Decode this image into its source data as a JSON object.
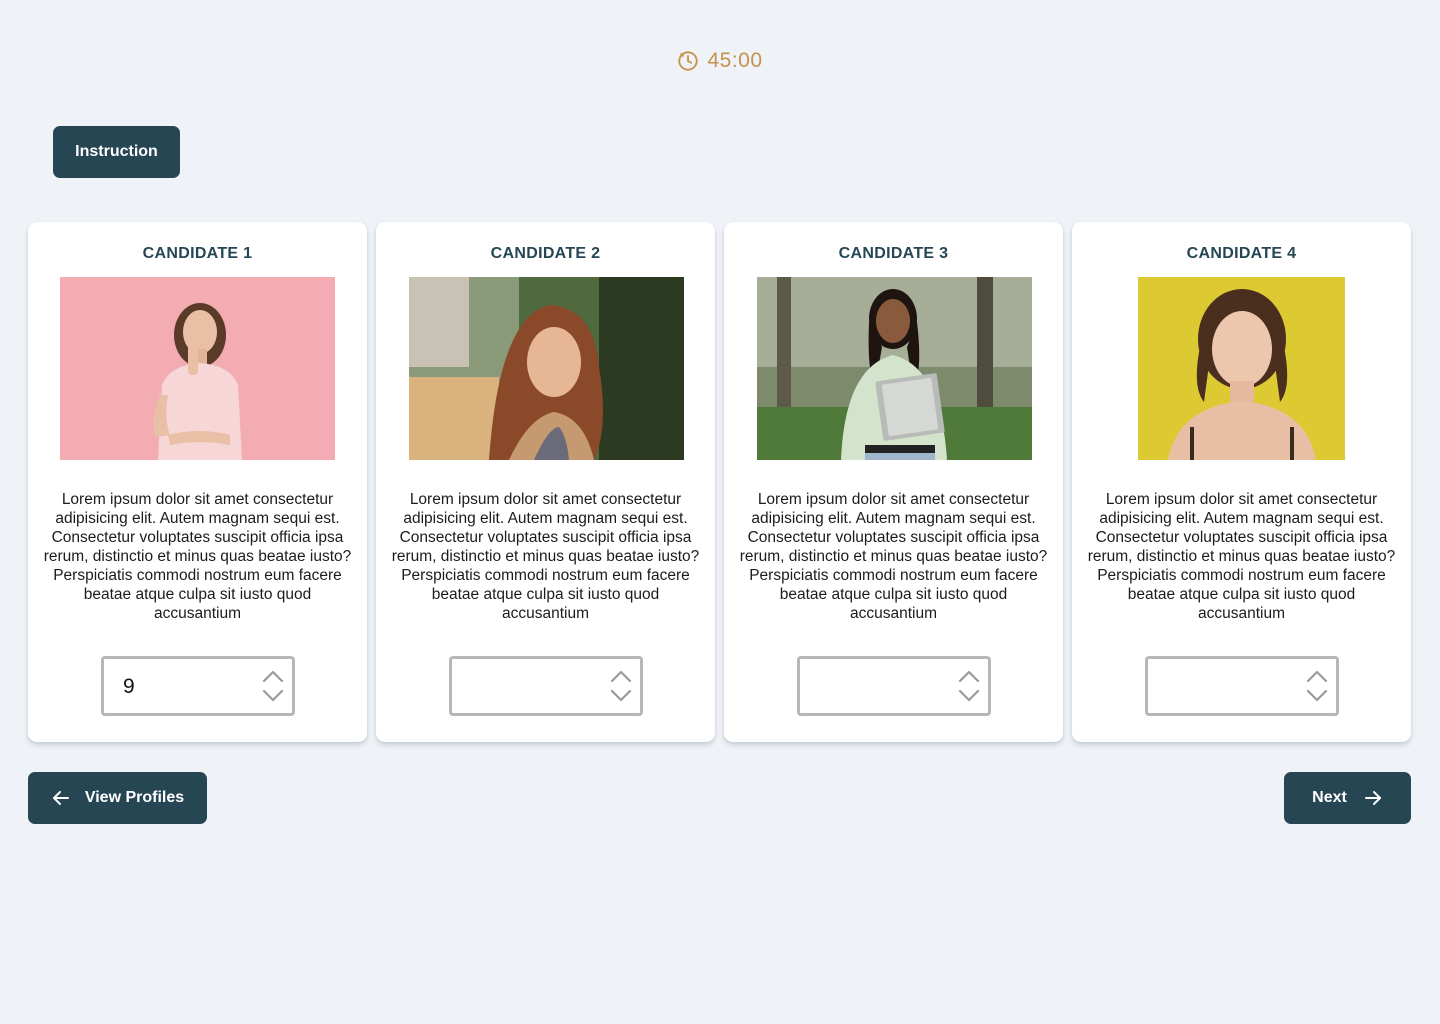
{
  "timer": {
    "icon": "clock-icon",
    "value": "45:00",
    "color": "#c5924b"
  },
  "instruction_button": {
    "label": "Instruction"
  },
  "candidates": [
    {
      "title": "CANDIDATE 1",
      "description": "Lorem ipsum dolor sit amet consectetur adipisicing elit. Autem magnam sequi est. Consectetur voluptates suscipit officia ipsa rerum, distinctio et minus quas beatae iusto? Perspiciatis commodi nostrum eum facere beatae atque culpa sit iusto quod accusantium",
      "rank_value": "9"
    },
    {
      "title": "CANDIDATE 2",
      "description": "Lorem ipsum dolor sit amet consectetur adipisicing elit. Autem magnam sequi est. Consectetur voluptates suscipit officia ipsa rerum, distinctio et minus quas beatae iusto? Perspiciatis commodi nostrum eum facere beatae atque culpa sit iusto quod accusantium",
      "rank_value": ""
    },
    {
      "title": "CANDIDATE 3",
      "description": "Lorem ipsum dolor sit amet consectetur adipisicing elit. Autem magnam sequi est. Consectetur voluptates suscipit officia ipsa rerum, distinctio et minus quas beatae iusto? Perspiciatis commodi nostrum eum facere beatae atque culpa sit iusto quod accusantium",
      "rank_value": ""
    },
    {
      "title": "CANDIDATE 4",
      "description": "Lorem ipsum dolor sit amet consectetur adipisicing elit. Autem magnam sequi est. Consectetur voluptates suscipit officia ipsa rerum, distinctio et minus quas beatae iusto? Perspiciatis commodi nostrum eum facere beatae atque culpa sit iusto quod accusantium",
      "rank_value": ""
    }
  ],
  "back_button": {
    "label": "View Profiles",
    "icon": "arrow-left-icon"
  },
  "next_button": {
    "label": "Next",
    "icon": "arrow-right-icon"
  },
  "colors": {
    "background": "#eff3f8",
    "primary": "#264654",
    "card": "#ffffff",
    "accent": "#c5924b"
  }
}
